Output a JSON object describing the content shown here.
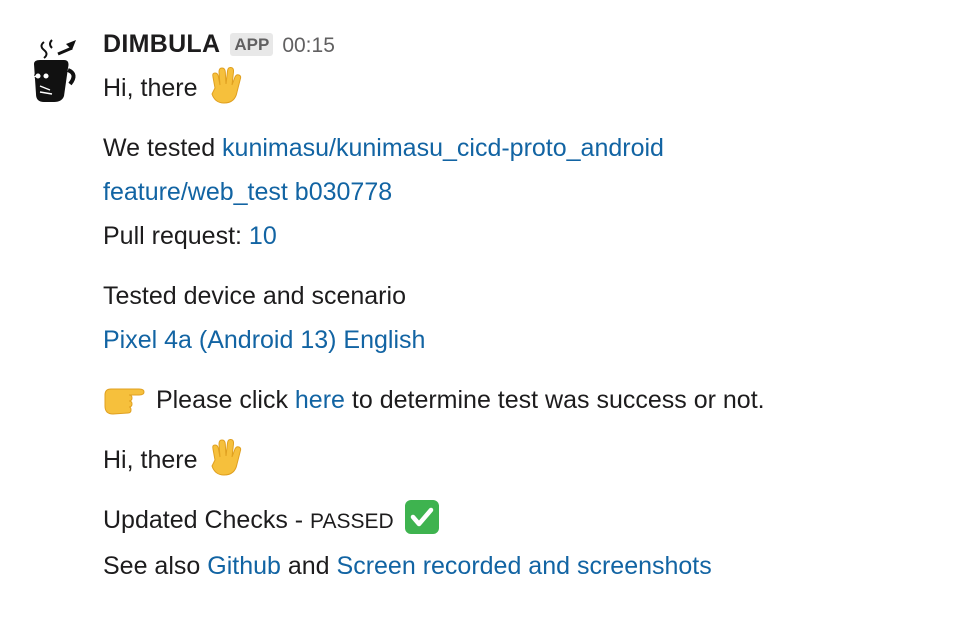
{
  "message": {
    "sender": "DIMBULA",
    "badge": "APP",
    "time": "00:15",
    "greeting_1": "Hi, there",
    "tested_prefix": "We tested ",
    "repo_link": "kunimasu/kunimasu_cicd-proto_android",
    "branch_link": "feature/web_test",
    "commit_link": "b030778",
    "pr_prefix": "Pull request: ",
    "pr_link": "10",
    "device_heading": "Tested device and scenario",
    "device_link": "Pixel 4a (Android 13) English",
    "please_click": " Please click ",
    "here_link": "here",
    "determine_text": " to determine test was success or not.",
    "greeting_2": "Hi, there",
    "checks_prefix": "Updated Checks - ",
    "checks_status": "PASSED",
    "see_also_prefix": "See also ",
    "github_link": "Github",
    "and_text": " and ",
    "screen_link": "Screen recorded and screenshots"
  },
  "icons": {
    "avatar": "bot-avatar-icon",
    "wave": "raised-hand-icon",
    "pointing": "pointing-right-icon",
    "check": "check-mark-icon"
  },
  "colors": {
    "link": "#1264a3",
    "text": "#1d1c1d",
    "muted": "#616061",
    "badge_bg": "#e8e8e8",
    "check_green": "#3eb34f",
    "hand_yellow": "#f6c03c"
  }
}
